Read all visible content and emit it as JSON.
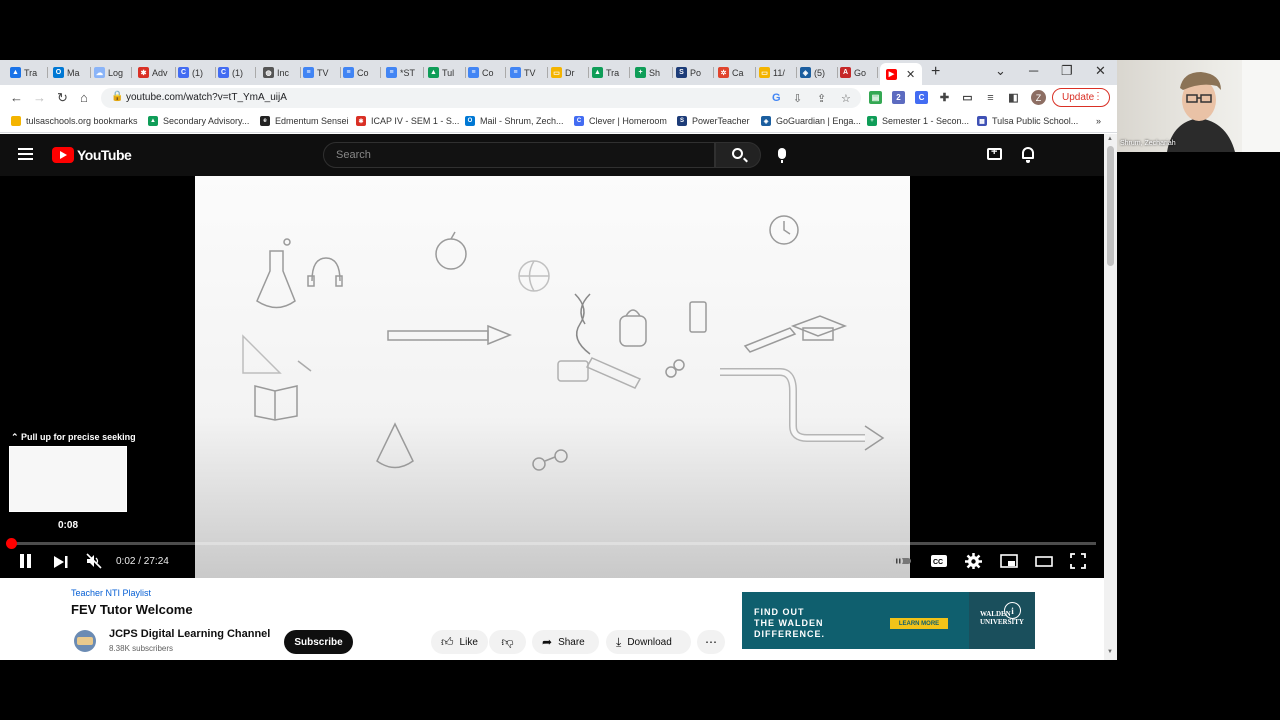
{
  "browser": {
    "tabs": [
      {
        "label": "Tra",
        "icon": "drive-icon",
        "color": "#1a73e8",
        "glyph": "▲"
      },
      {
        "label": "Ma",
        "icon": "outlook-icon",
        "color": "#0078d4",
        "glyph": "O"
      },
      {
        "label": "Log",
        "icon": "cloud-icon",
        "color": "#8ab4f8",
        "glyph": "☁"
      },
      {
        "label": "Adv",
        "icon": "adv-icon",
        "color": "#d93025",
        "glyph": "✱"
      },
      {
        "label": "(1)",
        "icon": "clever-icon",
        "color": "#436cf2",
        "glyph": "C"
      },
      {
        "label": "(1)",
        "icon": "clever-icon",
        "color": "#436cf2",
        "glyph": "C"
      },
      {
        "label": "Inc",
        "icon": "globe-icon",
        "color": "#555555",
        "glyph": "◍"
      },
      {
        "label": "TV",
        "icon": "docs-icon",
        "color": "#4285f4",
        "glyph": "≡"
      },
      {
        "label": "Co",
        "icon": "docs-icon",
        "color": "#4285f4",
        "glyph": "≡"
      },
      {
        "label": "*ST",
        "icon": "docs-icon",
        "color": "#4285f4",
        "glyph": "≡"
      },
      {
        "label": "Tul",
        "icon": "drive-icon",
        "color": "#0f9d58",
        "glyph": "▲"
      },
      {
        "label": "Co",
        "icon": "docs-icon",
        "color": "#4285f4",
        "glyph": "≡"
      },
      {
        "label": "TV",
        "icon": "docs-icon",
        "color": "#4285f4",
        "glyph": "≡"
      },
      {
        "label": "Dr",
        "icon": "slides-icon",
        "color": "#f4b400",
        "glyph": "▭"
      },
      {
        "label": "Tra",
        "icon": "drive-icon",
        "color": "#0f9d58",
        "glyph": "▲"
      },
      {
        "label": "Sh",
        "icon": "sheets-icon",
        "color": "#0f9d58",
        "glyph": "+"
      },
      {
        "label": "Po",
        "icon": "sis-icon",
        "color": "#1d3c78",
        "glyph": "S"
      },
      {
        "label": "Ca",
        "icon": "canvas-icon",
        "color": "#e0442d",
        "glyph": "✲"
      },
      {
        "label": "11/",
        "icon": "slides-icon",
        "color": "#f4b400",
        "glyph": "▭"
      },
      {
        "label": "(5)",
        "icon": "shield-icon",
        "color": "#1b5e9f",
        "glyph": "◈"
      },
      {
        "label": "Go",
        "icon": "adobe-icon",
        "color": "#c62828",
        "glyph": "A"
      }
    ],
    "active_tab_icon": "youtube-icon",
    "url": "youtube.com/watch?v=tT_YmA_uijA",
    "profile_initial": "Z",
    "update_label": "Update",
    "bookmarks": [
      {
        "label": "tulsaschools.org bookmarks",
        "icon": "folder-icon",
        "color": "#f4b400",
        "glyph": ""
      },
      {
        "label": "Secondary Advisory...",
        "icon": "drive-icon",
        "color": "#0f9d58",
        "glyph": "▲"
      },
      {
        "label": "Edmentum Sensei",
        "icon": "edmentum-icon",
        "color": "#222222",
        "glyph": "e"
      },
      {
        "label": "ICAP IV - SEM 1 - S...",
        "icon": "icap-icon",
        "color": "#d93025",
        "glyph": "✱"
      },
      {
        "label": "Mail - Shrum, Zech...",
        "icon": "outlook-icon",
        "color": "#0078d4",
        "glyph": "O"
      },
      {
        "label": "Clever | Homeroom",
        "icon": "clever-icon",
        "color": "#436cf2",
        "glyph": "C"
      },
      {
        "label": "PowerTeacher",
        "icon": "sis-icon",
        "color": "#1d3c78",
        "glyph": "S"
      },
      {
        "label": "GoGuardian | Enga...",
        "icon": "shield-icon",
        "color": "#1b5e9f",
        "glyph": "◈"
      },
      {
        "label": "Semester 1 - Secon...",
        "icon": "sheets-icon",
        "color": "#0f9d58",
        "glyph": "+"
      },
      {
        "label": "Tulsa Public School...",
        "icon": "school-icon",
        "color": "#3f51b5",
        "glyph": "▦"
      }
    ]
  },
  "youtube": {
    "logo_text": "YouTube",
    "search_placeholder": "Search",
    "player": {
      "preview_hint": "Pull up for precise seeking",
      "preview_time": "0:08",
      "current_time": "0:02",
      "duration": "27:24",
      "time_display": "0:02 / 27:24",
      "progress_fraction": 0.0012,
      "muted": true
    },
    "playlist": "Teacher NTI Playlist",
    "title": "FEV Tutor Welcome",
    "channel": "JCPS Digital Learning Channel",
    "subscribers": "8.38K subscribers",
    "subscribe_label": "Subscribe",
    "like_label": "Like",
    "share_label": "Share",
    "download_label": "Download",
    "ad": {
      "line1": "FIND OUT",
      "line2": "THE WALDEN",
      "line3": "DIFFERENCE.",
      "cta": "LEARN MORE",
      "brand_line1": "WALDEN",
      "brand_line2": "UNIVERSITY",
      "info": "i"
    }
  },
  "webcam": {
    "name": "Shrum, Zechariah"
  },
  "colors": {
    "youtube_red": "#ff0000",
    "update_red": "#d93025",
    "link_blue": "#065fd4"
  }
}
